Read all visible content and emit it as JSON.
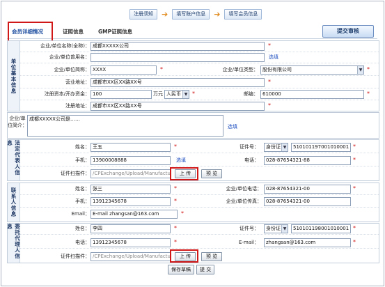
{
  "steps": [
    "注册须知",
    "填写账户信息",
    "填写会员信息"
  ],
  "tabs": [
    "会员详细情况",
    "证照信息",
    "GMP证照信息"
  ],
  "submit_label": "提交审核",
  "unit": {
    "side": "单位基本信息",
    "name_label": "企业/单位名称(全称)：",
    "name_value": "成都XXXXX公司",
    "used_name_label": "企业/单位曾用名：",
    "select_link": "选填",
    "short_label": "企业/单位简称：",
    "short_value": "XXXX",
    "type_label": "企业/单位类型：",
    "type_value": "股份有限公司",
    "biz_addr_label": "营业地址：",
    "biz_addr_value": "成都市XX区XX路XX号",
    "capital_label": "注册资本/开办资金：",
    "capital_value": "100",
    "capital_unit": "万元",
    "currency_value": "人民币",
    "zip_label": "邮编：",
    "zip_value": "610000",
    "reg_addr_label": "注册地址：",
    "reg_addr_value": "成都市XX区XX路XX号"
  },
  "intro": {
    "label": "企业/单位简介：",
    "value": "成都XXXXX公司是……",
    "link": "选填"
  },
  "legal": {
    "side": "法定代表人信息",
    "name_label": "姓名：",
    "name_value": "王五",
    "id_label": "证件号：",
    "id_type": "身份证",
    "id_value": "510101197001010001",
    "mobile_label": "手机：",
    "mobile_value": "13900008888",
    "mobile_link": "选填",
    "phone_label": "电话：",
    "phone_value": "028-87654321-88",
    "scan_label": "证件扫描件：",
    "scan_value": "/CPExchange/Upload/Manufacture",
    "upload_label": "上 传",
    "preview_label": "预 览"
  },
  "contact": {
    "side": "联系人信息",
    "name_label": "姓名：",
    "name_value": "张三",
    "tel_label": "企业/单位电话：",
    "tel_value": "028-87654321-00",
    "mobile_label": "手机：",
    "mobile_value": "13912345678",
    "fax_label": "企业/单位传真：",
    "fax_value": "028-87654321-00",
    "email_label": "Email：",
    "email_value": "E-mail  zhangsan@163.com"
  },
  "agent": {
    "side": "委托代理人信息",
    "name_label": "姓名：",
    "name_value": "李四",
    "id_label": "证件号：",
    "id_type": "身份证",
    "id_value": "510101198001010001",
    "phone_label": "电话：",
    "phone_value": "13912345678",
    "email_label": "E-mail：",
    "email_value": "zhangsan@163.com",
    "scan_label": "证件扫描件：",
    "scan_value": "/CPExchange/Upload/Manufacture",
    "upload_label": "上 传",
    "preview_label": "预 览"
  },
  "bottom": {
    "save_label": "保存草稿",
    "submit_label": "提 交"
  },
  "colors": {
    "highlight": "#d01818",
    "required": "#d01010",
    "link": "#2050c0"
  }
}
